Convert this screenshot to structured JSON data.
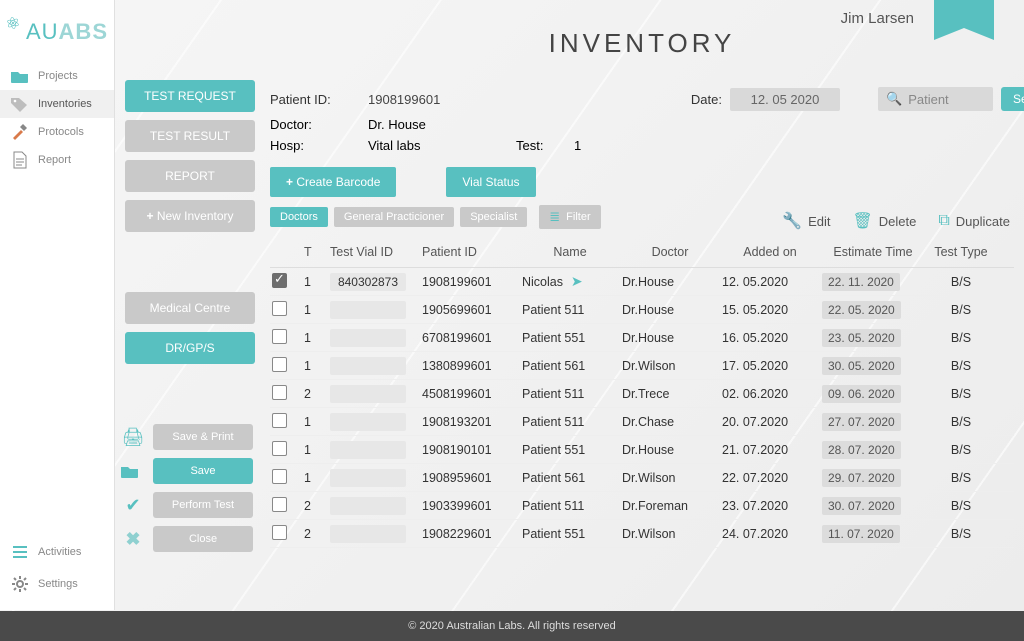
{
  "user_name": "Jim Larsen",
  "logo": {
    "text_a": "AU",
    "text_b": "ABS"
  },
  "page_title": "INVENTORY",
  "sidebar": {
    "items": [
      {
        "label": "Projects",
        "icon": "folder-icon",
        "active": false
      },
      {
        "label": "Inventories",
        "icon": "tag-icon",
        "active": true
      },
      {
        "label": "Protocols",
        "icon": "tools-icon",
        "active": false
      },
      {
        "label": "Report",
        "icon": "doc-icon",
        "active": false
      }
    ],
    "bottom": [
      {
        "label": "Activities",
        "icon": "list-icon"
      },
      {
        "label": "Settings",
        "icon": "gear-icon"
      }
    ]
  },
  "midcol": {
    "group1": [
      {
        "label": "TEST REQUEST",
        "style": "primary"
      },
      {
        "label": "TEST RESULT",
        "style": ""
      },
      {
        "label": "REPORT",
        "style": ""
      },
      {
        "label": "New Inventory",
        "style": "",
        "plus": true
      }
    ],
    "group2": [
      {
        "label": "Medical Centre",
        "style": ""
      },
      {
        "label": "DR/GP/S",
        "style": "primary"
      }
    ],
    "group3": [
      {
        "icon": "printer-icon",
        "label": "Save & Print",
        "style": "",
        "iconColor": "teal"
      },
      {
        "icon": "folder-icon",
        "label": "Save",
        "style": "primary",
        "iconColor": "teal"
      },
      {
        "icon": "check-icon",
        "label": "Perform Test",
        "style": "",
        "iconColor": "teal"
      },
      {
        "icon": "close-icon",
        "label": "Close",
        "style": "",
        "iconColor": "teal"
      }
    ]
  },
  "meta": {
    "patient_id_label": "Patient ID:",
    "patient_id": "1908199601",
    "doctor_label": "Doctor:",
    "doctor": "Dr. House",
    "hosp_label": "Hosp:",
    "hosp": "Vital labs",
    "test_label": "Test:",
    "test": "1",
    "date_label": "Date:",
    "date": "12. 05 2020"
  },
  "search": {
    "placeholder": "Patient",
    "button": "Search"
  },
  "actions": {
    "create_barcode": "Create Barcode",
    "vial_status": "Vial Status",
    "edit": "Edit",
    "delete": "Delete",
    "duplicate": "Duplicate"
  },
  "chips": {
    "doctors": "Doctors",
    "gp": "General Practicioner",
    "specialist": "Specialist",
    "filter": "Filter"
  },
  "table": {
    "headers": {
      "chk": "",
      "t": "T",
      "vial": "Test Vial ID",
      "patient": "Patient ID",
      "name": "Name",
      "doctor": "Doctor",
      "added": "Added on",
      "estimate": "Estimate Time",
      "type": "Test Type"
    },
    "rows": [
      {
        "chk": true,
        "t": "1",
        "vial": "840302873",
        "patient": "1908199601",
        "name": "Nicolas",
        "cursor": true,
        "doctor": "Dr.House",
        "added": "12. 05.2020",
        "estimate": "22. 11. 2020",
        "type": "B/S"
      },
      {
        "chk": false,
        "t": "1",
        "vial": "",
        "patient": "1905699601",
        "name": "Patient 511",
        "cursor": false,
        "doctor": "Dr.House",
        "added": "15. 05.2020",
        "estimate": "22. 05. 2020",
        "type": "B/S"
      },
      {
        "chk": false,
        "t": "1",
        "vial": "",
        "patient": "6708199601",
        "name": "Patient 551",
        "cursor": false,
        "doctor": "Dr.House",
        "added": "16. 05.2020",
        "estimate": "23. 05. 2020",
        "type": "B/S"
      },
      {
        "chk": false,
        "t": "1",
        "vial": "",
        "patient": "1380899601",
        "name": "Patient 561",
        "cursor": false,
        "doctor": "Dr.Wilson",
        "added": "17. 05.2020",
        "estimate": "30. 05. 2020",
        "type": "B/S"
      },
      {
        "chk": false,
        "t": "2",
        "vial": "",
        "patient": "4508199601",
        "name": "Patient 511",
        "cursor": false,
        "doctor": "Dr.Trece",
        "added": "02. 06.2020",
        "estimate": "09. 06. 2020",
        "type": "B/S"
      },
      {
        "chk": false,
        "t": "1",
        "vial": "",
        "patient": "1908193201",
        "name": "Patient 511",
        "cursor": false,
        "doctor": "Dr.Chase",
        "added": "20. 07.2020",
        "estimate": "27. 07. 2020",
        "type": "B/S"
      },
      {
        "chk": false,
        "t": "1",
        "vial": "",
        "patient": "1908190101",
        "name": "Patient 551",
        "cursor": false,
        "doctor": "Dr.House",
        "added": "21. 07.2020",
        "estimate": "28. 07. 2020",
        "type": "B/S"
      },
      {
        "chk": false,
        "t": "1",
        "vial": "",
        "patient": "1908959601",
        "name": "Patient 561",
        "cursor": false,
        "doctor": "Dr.Wilson",
        "added": "22. 07.2020",
        "estimate": "29. 07. 2020",
        "type": "B/S"
      },
      {
        "chk": false,
        "t": "2",
        "vial": "",
        "patient": "1903399601",
        "name": "Patient 511",
        "cursor": false,
        "doctor": "Dr.Foreman",
        "added": "23. 07.2020",
        "estimate": "30. 07. 2020",
        "type": "B/S"
      },
      {
        "chk": false,
        "t": "2",
        "vial": "",
        "patient": "1908229601",
        "name": "Patient 551",
        "cursor": false,
        "doctor": "Dr.Wilson",
        "added": "24. 07.2020",
        "estimate": "11. 07. 2020",
        "type": "B/S"
      }
    ]
  },
  "footer": "© 2020 Australian Labs. All rights reserved"
}
